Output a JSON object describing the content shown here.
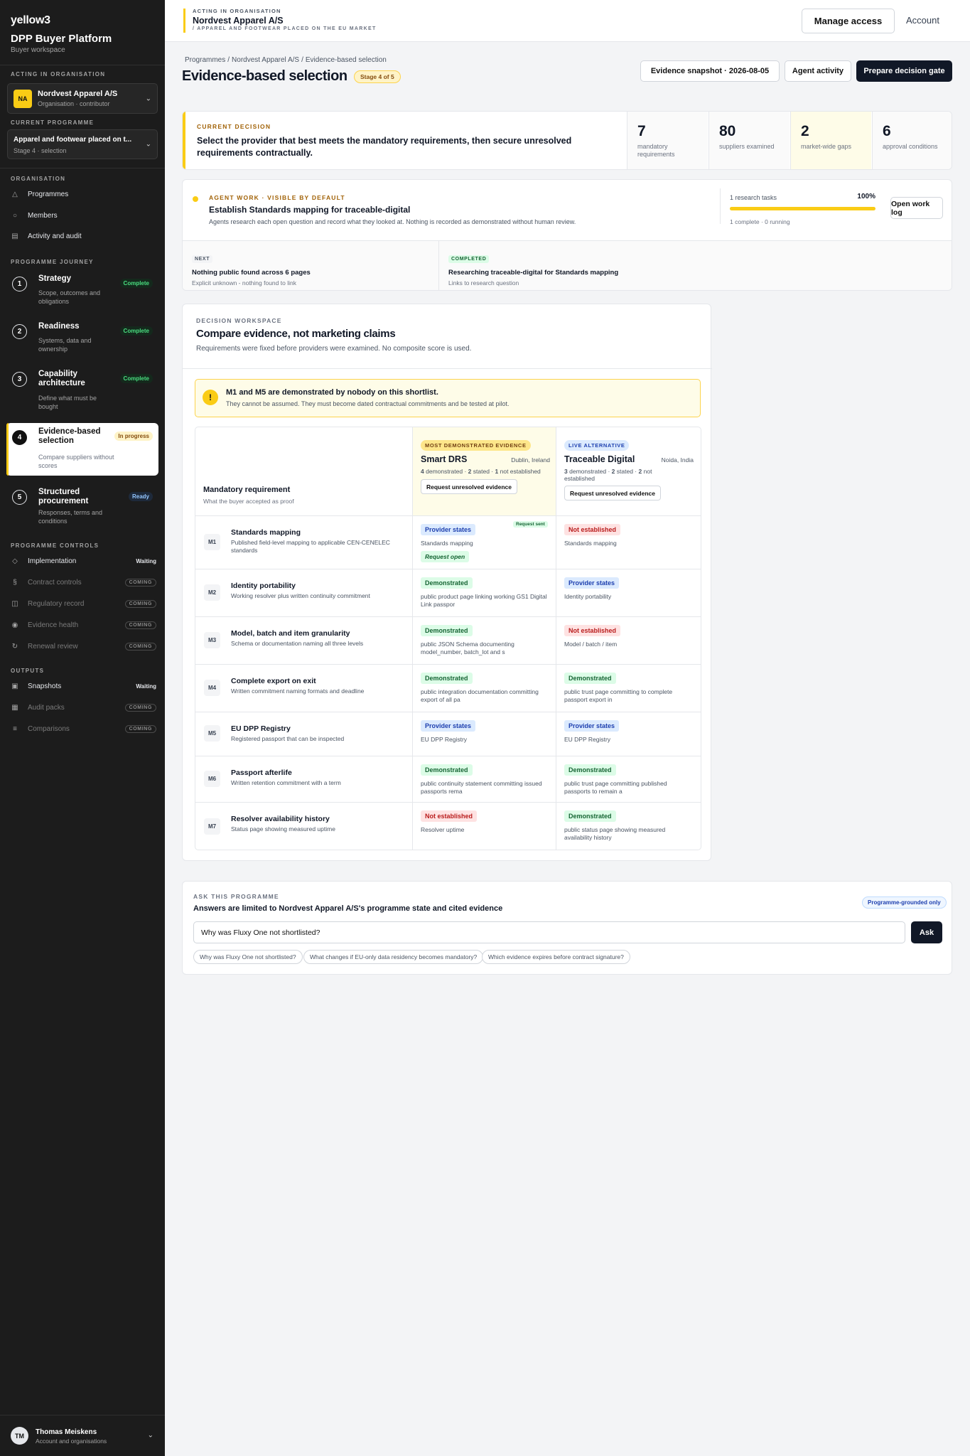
{
  "sidebar": {
    "brand": "yellow3",
    "title": "DPP Buyer Platform",
    "subtitle": "Buyer workspace",
    "acting_caption": "ACTING IN ORGANISATION",
    "org": {
      "initials": "NA",
      "name": "Nordvest Apparel A/S",
      "role": "Organisation · contributor"
    },
    "programme_caption": "CURRENT PROGRAMME",
    "programme": {
      "name": "Apparel and footwear placed on t...",
      "stage": "Stage 4 · selection"
    },
    "organisation_caption": "ORGANISATION",
    "org_nav": [
      {
        "label": "Programmes",
        "icon": "triangle-icon"
      },
      {
        "label": "Members",
        "icon": "circle-icon"
      },
      {
        "label": "Activity and audit",
        "icon": "list-icon"
      }
    ],
    "journey_caption": "PROGRAMME JOURNEY",
    "steps": [
      {
        "num": "1",
        "title": "Strategy",
        "desc": "Scope, outcomes and obligations",
        "badge": "Complete"
      },
      {
        "num": "2",
        "title": "Readiness",
        "desc": "Systems, data and ownership",
        "badge": "Complete"
      },
      {
        "num": "3",
        "title": "Capability architecture",
        "desc": "Define what must be bought",
        "badge": "Complete"
      },
      {
        "num": "4",
        "title": "Evidence-based selection",
        "desc": "Compare suppliers without scores",
        "badge": "In progress"
      },
      {
        "num": "5",
        "title": "Structured procurement",
        "desc": "Responses, terms and conditions",
        "badge": "Ready"
      }
    ],
    "controls_caption": "PROGRAMME CONTROLS",
    "controls": [
      {
        "label": "Implementation",
        "tag": "Waiting"
      },
      {
        "label": "Contract controls",
        "tag": "COMING"
      },
      {
        "label": "Regulatory record",
        "tag": "COMING"
      },
      {
        "label": "Evidence health",
        "tag": "COMING"
      },
      {
        "label": "Renewal review",
        "tag": "COMING"
      }
    ],
    "outputs_caption": "OUTPUTS",
    "outputs": [
      {
        "label": "Snapshots",
        "tag": "Waiting"
      },
      {
        "label": "Audit packs",
        "tag": "COMING"
      },
      {
        "label": "Comparisons",
        "tag": "COMING"
      }
    ],
    "user": {
      "initials": "TM",
      "name": "Thomas Meiskens",
      "sub": "Account and organisations"
    }
  },
  "topbar": {
    "caption": "ACTING IN ORGANISATION",
    "org": "Nordvest Apparel A/S",
    "programme": "/ APPAREL AND FOOTWEAR PLACED ON THE EU MARKET",
    "manage_access": "Manage access",
    "account": "Account"
  },
  "page": {
    "breadcrumbs": [
      "Programmes",
      "Nordvest Apparel A/S",
      "Evidence-based selection"
    ],
    "title": "Evidence-based selection",
    "stage": "Stage 4 of 5",
    "snapshot_btn": "Evidence snapshot · 2026-08-05",
    "agent_btn": "Agent activity",
    "gate_btn": "Prepare decision gate"
  },
  "decision": {
    "caption": "CURRENT DECISION",
    "text": "Select the provider that best meets the mandatory requirements, then secure unresolved requirements contractually.",
    "stats": [
      {
        "n": "7",
        "l": "mandatory requirements"
      },
      {
        "n": "80",
        "l": "suppliers examined"
      },
      {
        "n": "2",
        "l": "market-wide gaps"
      },
      {
        "n": "6",
        "l": "approval conditions"
      }
    ]
  },
  "agent": {
    "caption": "AGENT WORK · VISIBLE BY DEFAULT",
    "title": "Establish Standards mapping for traceable-digital",
    "desc": "Agents research each open question and record what they looked at. Nothing is recorded as demonstrated without human review.",
    "tasks": "1 research tasks",
    "percent": "100%",
    "progress": 1.0,
    "sub": "1 complete · 0 running",
    "open_log": "Open work log",
    "next": {
      "tag": "NEXT",
      "title": "Nothing public found across 6 pages",
      "sub": "Explicit unknown - nothing found to link"
    },
    "completed": {
      "tag": "COMPLETED",
      "title": "Researching traceable-digital for Standards mapping",
      "sub": "Links to research question"
    }
  },
  "workspace": {
    "caption": "DECISION WORKSPACE",
    "title": "Compare evidence, not marketing claims",
    "sub": "Requirements were fixed before providers were examined. No composite score is used.",
    "warning_title": "M1 and M5 are demonstrated by nobody on this shortlist.",
    "warning_text": "They cannot be assumed. They must become dated contractual commitments and be tested at pilot.",
    "req_header": "Mandatory requirement",
    "req_sub": "What the buyer accepted as proof",
    "providers": [
      {
        "tag": "MOST DEMONSTRATED EVIDENCE",
        "name": "Smart DRS",
        "loc": "Dublin, Ireland",
        "d": "4",
        "s": "2",
        "n": "1",
        "summary_d": "demonstrated ·",
        "summary_s": "stated ·",
        "summary_n": "not established",
        "btn": "Request unresolved evidence"
      },
      {
        "tag": "LIVE ALTERNATIVE",
        "name": "Traceable Digital",
        "loc": "Noida, India",
        "d": "3",
        "s": "2",
        "n": "2",
        "summary_d": "demonstrated ·",
        "summary_s": "stated ·",
        "summary_n": "not established",
        "btn": "Request unresolved evidence"
      }
    ],
    "request_sent": "Request sent",
    "request_open": "Request open",
    "rows": [
      {
        "code": "M1",
        "title": "Standards mapping",
        "desc": "Published field-level mapping to applicable CEN-CENELEC standards",
        "a": {
          "status": "Provider states",
          "ev": "Standards mapping"
        },
        "b": {
          "status": "Not established",
          "ev": "Standards mapping"
        }
      },
      {
        "code": "M2",
        "title": "Identity portability",
        "desc": "Working resolver plus written continuity commitment",
        "a": {
          "status": "Demonstrated",
          "ev": "public product page linking working GS1 Digital Link passpor"
        },
        "b": {
          "status": "Provider states",
          "ev": "Identity portability"
        }
      },
      {
        "code": "M3",
        "title": "Model, batch and item granularity",
        "desc": "Schema or documentation naming all three levels",
        "a": {
          "status": "Demonstrated",
          "ev": "public JSON Schema documenting model_number, batch_lot and s"
        },
        "b": {
          "status": "Not established",
          "ev": "Model / batch / item"
        }
      },
      {
        "code": "M4",
        "title": "Complete export on exit",
        "desc": "Written commitment naming formats and deadline",
        "a": {
          "status": "Demonstrated",
          "ev": "public integration documentation committing export of all pa"
        },
        "b": {
          "status": "Demonstrated",
          "ev": "public trust page committing to complete passport export in"
        }
      },
      {
        "code": "M5",
        "title": "EU DPP Registry",
        "desc": "Registered passport that can be inspected",
        "a": {
          "status": "Provider states",
          "ev": "EU DPP Registry"
        },
        "b": {
          "status": "Provider states",
          "ev": "EU DPP Registry"
        }
      },
      {
        "code": "M6",
        "title": "Passport afterlife",
        "desc": "Written retention commitment with a term",
        "a": {
          "status": "Demonstrated",
          "ev": "public continuity statement committing issued passports rema"
        },
        "b": {
          "status": "Demonstrated",
          "ev": "public trust page committing published passports to remain a"
        }
      },
      {
        "code": "M7",
        "title": "Resolver availability history",
        "desc": "Status page showing measured uptime",
        "a": {
          "status": "Not established",
          "ev": "Resolver uptime"
        },
        "b": {
          "status": "Demonstrated",
          "ev": "public status page showing measured availability history"
        }
      }
    ]
  },
  "ask": {
    "caption": "ASK THIS PROGRAMME",
    "title": "Answers are limited to Nordvest Apparel A/S's programme state and cited evidence",
    "badge": "Programme-grounded only",
    "input_value": "Why was Fluxy One not shortlisted?",
    "button": "Ask",
    "suggestions": [
      "Why was Fluxy One not shortlisted?",
      "What changes if EU-only data residency becomes mandatory?",
      "Which evidence expires before contract signature?"
    ]
  },
  "colors": {
    "accent": "#facc15",
    "sidebar_bg": "#1c1c1c",
    "demonstrated": "#166534",
    "stated": "#1e40af",
    "not_established": "#b91c1c"
  }
}
